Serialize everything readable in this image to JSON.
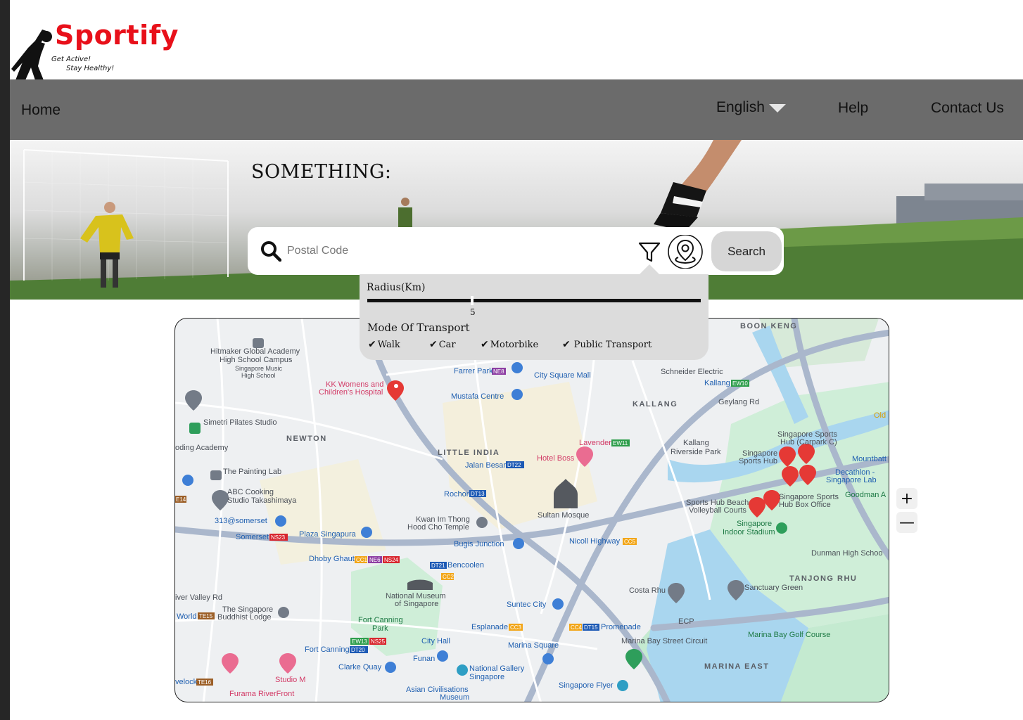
{
  "brand": {
    "name": "Sportify",
    "tagline_1": "Get Active!",
    "tagline_2": "Stay Healthy!",
    "color": "#e8101a"
  },
  "nav": {
    "home": "Home",
    "language": "English",
    "help": "Help",
    "contact": "Contact Us"
  },
  "hero": {
    "title": "SOMETHING:"
  },
  "search": {
    "placeholder": "Postal Code",
    "button": "Search",
    "icons": [
      "search-icon",
      "filter-icon",
      "location-pin-icon"
    ]
  },
  "filter": {
    "radius_label": "Radius(Km)",
    "radius_value": "5",
    "transport_label": "Mode Of Transport",
    "options": [
      {
        "label": "Walk",
        "checked": true
      },
      {
        "label": "Car",
        "checked": true
      },
      {
        "label": "Motorbike",
        "checked": true
      },
      {
        "label": "Public Transport",
        "checked": true
      }
    ]
  },
  "map": {
    "zoom_in": "+",
    "zoom_out": "—",
    "labels": {
      "boon_keng": "BOON KENG",
      "hitmaker": "Hitmaker Global Academy",
      "hitmaker2": "High School Campus",
      "sing_music": "Singapore Music",
      "sing_music2": "High School",
      "kk": "KK Womens and",
      "kk2": "Children's Hospital",
      "farrer": "Farrer Park",
      "city_square": "City Square Mall",
      "schneider": "Schneider Electric",
      "kallang_stn": "Kallang",
      "mustafa": "Mustafa Centre",
      "kallang": "KALLANG",
      "geylang_rd": "Geylang Rd",
      "simetri": "Simetri Pilates Studio",
      "newton": "NEWTON",
      "little_india": "LITTLE INDIA",
      "lavender": "Lavender",
      "kallang_park": "Kallang",
      "kallang_park2": "Riverside Park",
      "sports_hub_cp": "Singapore Sports",
      "sports_hub_cp2": "Hub (Carpark C)",
      "sports_hub": "Singapore",
      "sports_hub2": "Sports Hub",
      "academy": "oding Academy",
      "painting_lab": "The Painting Lab",
      "jalan_besar": "Jalan Besar",
      "hotel_boss": "Hotel Boss",
      "decathlon": "Decathlon -",
      "decathlon2": "Singapore Lab",
      "abc": "ABC Cooking",
      "abc2": "Studio Takashimaya",
      "rochor": "Rochor",
      "sultan": "Sultan Mosque",
      "beach_vb": "Sports Hub Beach",
      "beach_vb2": "Volleyball Courts",
      "box_office": "Singapore Sports",
      "box_office2": "Hub Box Office",
      "goodman": "Goodman A",
      "somerset313": "313@somerset",
      "kwan_im": "Kwan Im Thong",
      "kwan_im2": "Hood Cho Temple",
      "indoor": "Singapore",
      "indoor2": "Indoor Stadium",
      "somerset": "Somerset",
      "plaza": "Plaza Singapura",
      "bugis": "Bugis Junction",
      "nicoll": "Nicoll Highway",
      "dunman": "Dunman High Schoo",
      "dhoby": "Dhoby Ghaut",
      "bencoolen": "Bencoolen",
      "tanjong": "TANJONG RHU",
      "costa": "Costa Rhu",
      "sanctuary": "Sanctuary Green",
      "valley": "iver Valley Rd",
      "museum": "National Museum",
      "museum2": "of Singapore",
      "suntec": "Suntec City",
      "buddhist": "The Singapore",
      "buddhist2": "Buddhist Lodge",
      "world": "World",
      "canning": "Fort Canning",
      "canning2": "Park",
      "esplanade": "Esplanade",
      "promenade": "Promenade",
      "ecp": "ECP",
      "marina_circuit": "Marina Bay Street Circuit",
      "golf": "Marina Bay Golf Course",
      "fc_stn": "Fort Canning",
      "city_hall": "City Hall",
      "marina_sq": "Marina Square",
      "funan": "Funan",
      "marina_east": "MARINA EAST",
      "clarke": "Clarke Quay",
      "natgallery": "National Gallery",
      "natgallery2": "Singapore",
      "studio_m": "Studio M",
      "flyer": "Singapore Flyer",
      "furama": "Furama RiverFront",
      "civilisations": "Asian Civilisations",
      "civilisations2": "Museum",
      "velock": "velock",
      "old": "Old",
      "mountbatten": "Mountbatt"
    }
  }
}
